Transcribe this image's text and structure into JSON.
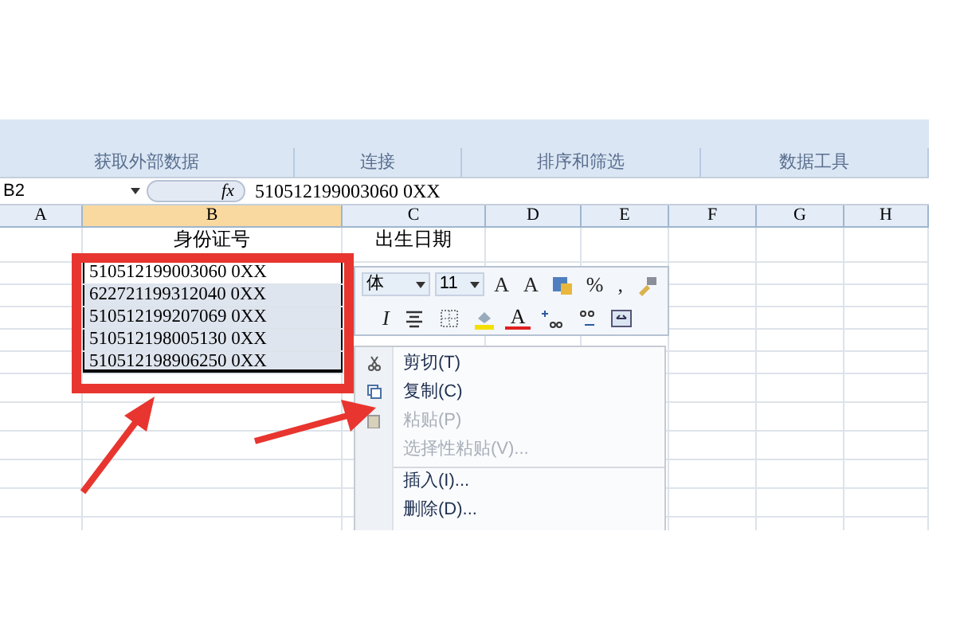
{
  "ribbon": {
    "groups": [
      "获取外部数据",
      "连接",
      "排序和筛选",
      "数据工具"
    ]
  },
  "formula_bar": {
    "name_box": "B2",
    "fx": "fx",
    "value": "510512199003060 0XX"
  },
  "columns": [
    {
      "label": "A",
      "selected": false
    },
    {
      "label": "B",
      "selected": true
    },
    {
      "label": "C",
      "selected": false
    },
    {
      "label": "D",
      "selected": false
    },
    {
      "label": "E",
      "selected": false
    },
    {
      "label": "F",
      "selected": false
    },
    {
      "label": "G",
      "selected": false
    },
    {
      "label": "H",
      "selected": false
    }
  ],
  "header_row": {
    "column_b": "身份证号",
    "column_c": "出生日期"
  },
  "id_rows": [
    {
      "value": "510512199003060 0XX",
      "selected": true,
      "active": true
    },
    {
      "value": "622721199312040 0XX",
      "selected": true,
      "active": false
    },
    {
      "value": "510512199207069 0XX",
      "selected": true,
      "active": false
    },
    {
      "value": "510512198005130 0XX",
      "selected": true,
      "active": false
    },
    {
      "value": "510512198906250 0XX",
      "selected": true,
      "active": false
    }
  ],
  "mini_toolbar": {
    "font": "体",
    "size": "11",
    "row_1": [
      {
        "kind": "text",
        "label": "A"
      },
      {
        "kind": "text",
        "label": "A"
      },
      {
        "kind": "styles"
      },
      {
        "kind": "text",
        "label": "%"
      },
      {
        "kind": "text",
        "label": ","
      },
      {
        "kind": "painter"
      }
    ],
    "row_2": [
      {
        "kind": "text",
        "label": "I"
      },
      {
        "kind": "align"
      },
      {
        "kind": "borders"
      },
      {
        "kind": "fill"
      },
      {
        "kind": "text",
        "label": "A"
      },
      {
        "kind": "increase"
      },
      {
        "kind": "decrease"
      },
      {
        "kind": "merge"
      }
    ]
  },
  "context_menu": {
    "items": [
      {
        "label": "剪切(T)",
        "disabled": false,
        "separator_before": false
      },
      {
        "label": "复制(C)",
        "disabled": false,
        "separator_before": false
      },
      {
        "label": "粘贴(P)",
        "disabled": true,
        "separator_before": false
      },
      {
        "label": "选择性粘贴(V)...",
        "disabled": true,
        "separator_before": false
      },
      {
        "label": "插入(I)...",
        "disabled": false,
        "separator_before": true
      },
      {
        "label": "删除(D)...",
        "disabled": false,
        "separator_before": false
      }
    ]
  }
}
